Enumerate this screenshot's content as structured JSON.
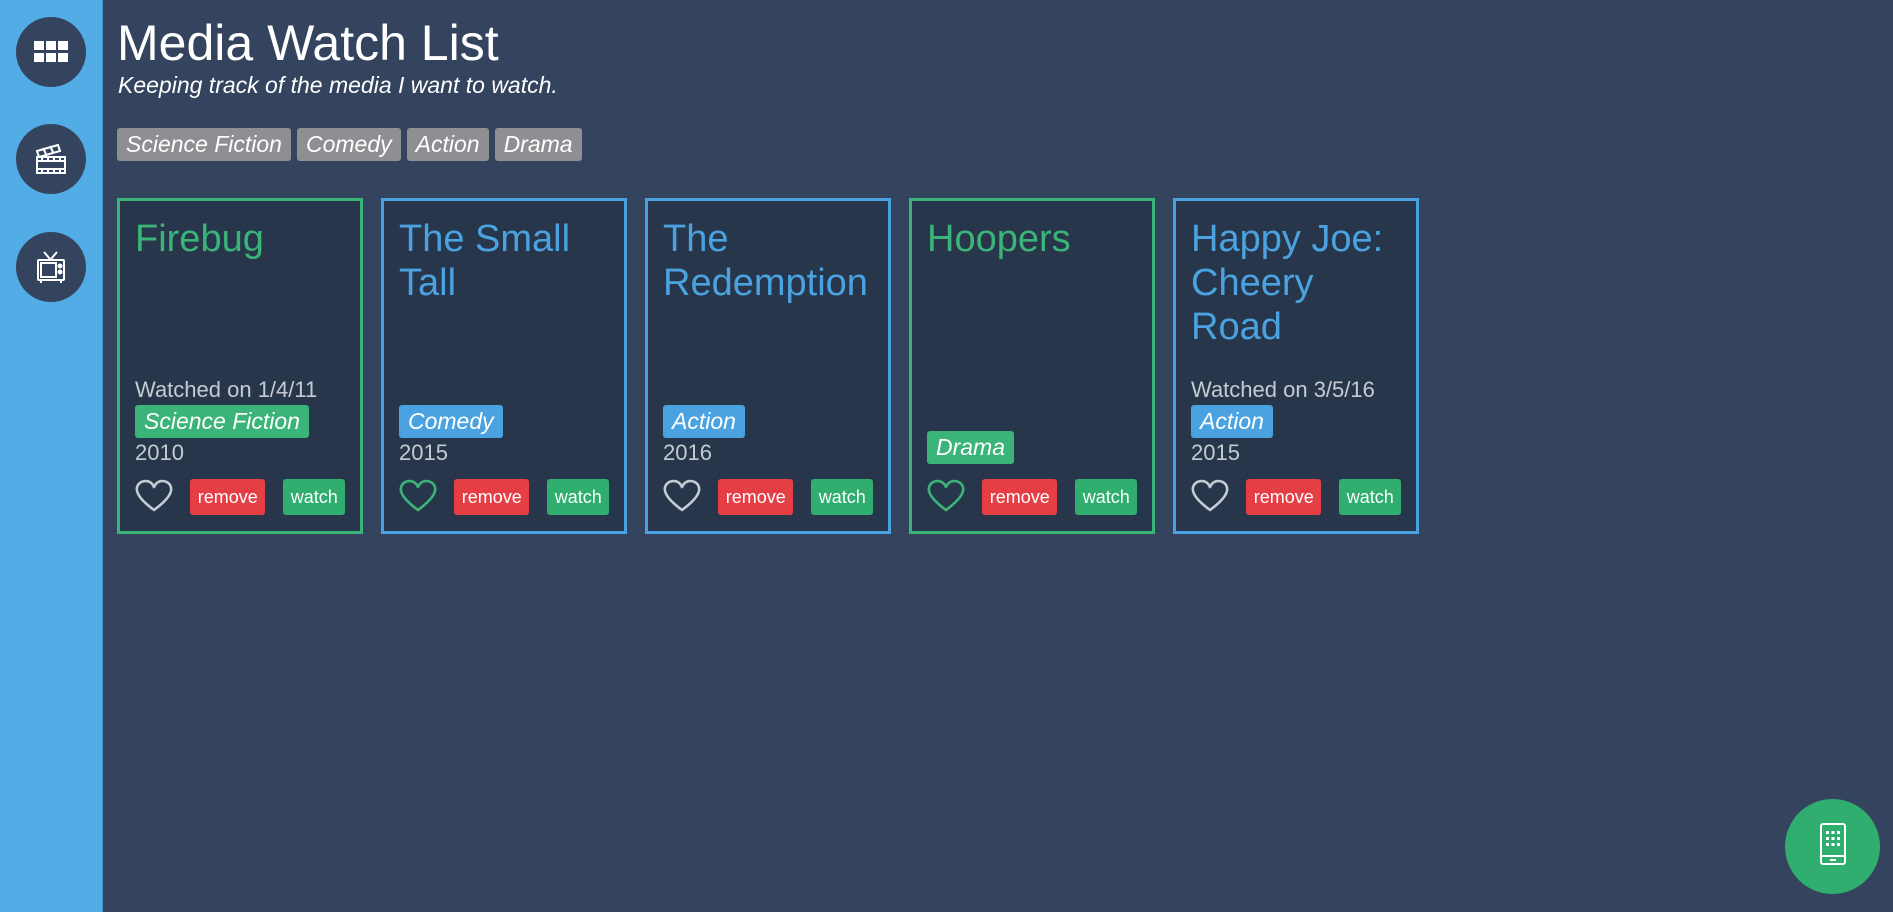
{
  "header": {
    "title": "Media Watch List",
    "subtitle": "Keeping track of the media I want to watch."
  },
  "sidebar": {
    "items": [
      {
        "icon": "grid-icon",
        "label": "All"
      },
      {
        "icon": "film-icon",
        "label": "Movies"
      },
      {
        "icon": "tv-icon",
        "label": "TV"
      }
    ]
  },
  "filters": [
    "Science Fiction",
    "Comedy",
    "Action",
    "Drama"
  ],
  "cards": [
    {
      "title": "Firebug",
      "watched": "Watched on 1/4/11",
      "genre": "Science Fiction",
      "year": "2010",
      "color": "green",
      "favorite": false
    },
    {
      "title": "The Small Tall",
      "watched": "",
      "genre": "Comedy",
      "year": "2015",
      "color": "blue",
      "favorite": true
    },
    {
      "title": "The Redemption",
      "watched": "",
      "genre": "Action",
      "year": "2016",
      "color": "blue",
      "favorite": false
    },
    {
      "title": "Hoopers",
      "watched": "",
      "genre": "Drama",
      "year": "",
      "color": "green",
      "favorite": true
    },
    {
      "title": "Happy Joe: Cheery Road",
      "watched": "Watched on 3/5/16",
      "genre": "Action",
      "year": "2015",
      "color": "blue",
      "favorite": false
    }
  ],
  "actions": {
    "remove": "remove",
    "watch": "watch"
  },
  "colors": {
    "background": "#34445e",
    "sidebar": "#52ace6",
    "card": "#28364b",
    "green": "#3ab478",
    "blue": "#4aa3e0",
    "remove": "#e53e45",
    "watch": "#2fae70",
    "tag_gray": "#8e8f92"
  },
  "fab": {
    "icon": "mobile-device-icon"
  }
}
